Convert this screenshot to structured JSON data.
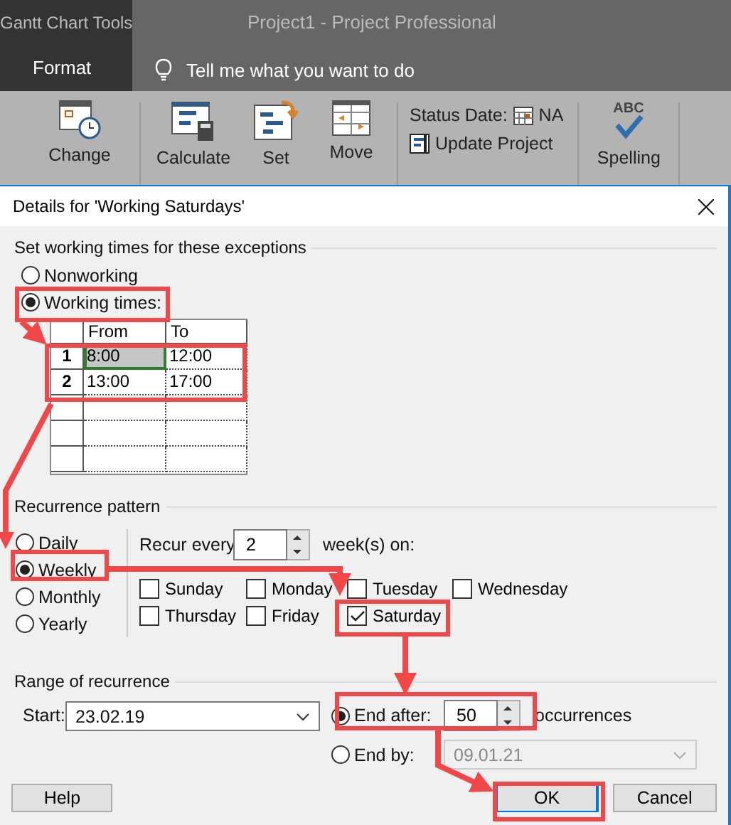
{
  "app": {
    "context_group": "Gantt Chart Tools",
    "title": "Project1  -  Project Professional",
    "active_tab": "Format",
    "tell_me": "Tell me what you want to do"
  },
  "ribbon": {
    "buttons": [
      {
        "label": "Change",
        "kind": "calendar"
      },
      {
        "label": "Calculate",
        "kind": "calculate"
      },
      {
        "label": "Set",
        "kind": "baseline"
      },
      {
        "label": "Move",
        "kind": "move"
      }
    ],
    "status_date_label": "Status Date:",
    "status_date_value": "NA",
    "update_project": "Update Project",
    "spelling_mark": "ABC",
    "spelling_label": "Spelling"
  },
  "dialog": {
    "title": "Details for 'Working Saturdays'",
    "working_times": {
      "title": "Set working times for these exceptions",
      "options": [
        {
          "label": "Nonworking",
          "selected": false
        },
        {
          "label": "Working times:",
          "selected": true
        }
      ],
      "columns": [
        "From",
        "To"
      ],
      "rows": [
        {
          "number": "1",
          "cells": [
            {
              "text": "8:00",
              "selected": true
            },
            {
              "text": "12:00",
              "selected": false
            }
          ]
        },
        {
          "number": "2",
          "cells": [
            {
              "text": "13:00",
              "selected": false
            },
            {
              "text": "17:00",
              "selected": false
            }
          ]
        }
      ]
    },
    "recurrence": {
      "title": "Recurrence pattern",
      "options": [
        {
          "label": "Daily",
          "selected": false
        },
        {
          "label": "Weekly",
          "selected": true
        },
        {
          "label": "Monthly",
          "selected": false
        },
        {
          "label": "Yearly",
          "selected": false
        }
      ],
      "recur_label": "Recur every",
      "interval": "2",
      "unit": "week(s) on:",
      "days": [
        {
          "label": "Sunday",
          "checked": false
        },
        {
          "label": "Monday",
          "checked": false
        },
        {
          "label": "Tuesday",
          "checked": false
        },
        {
          "label": "Wednesday",
          "checked": false
        },
        {
          "label": "Thursday",
          "checked": false
        },
        {
          "label": "Friday",
          "checked": false
        },
        {
          "label": "Saturday",
          "checked": true
        }
      ]
    },
    "range": {
      "title": "Range of recurrence",
      "start_label": "Start:",
      "start_value": "23.02.19",
      "end_options": [
        {
          "label": "End after:",
          "selected": true,
          "kind": "count",
          "value": "50",
          "suffix": "occurrences"
        },
        {
          "label": "End by:",
          "selected": false,
          "kind": "date",
          "value": "09.01.21"
        }
      ]
    },
    "buttons": [
      {
        "label": "Help",
        "default": false
      },
      {
        "label": "OK",
        "default": true
      },
      {
        "label": "Cancel",
        "default": false
      }
    ]
  }
}
